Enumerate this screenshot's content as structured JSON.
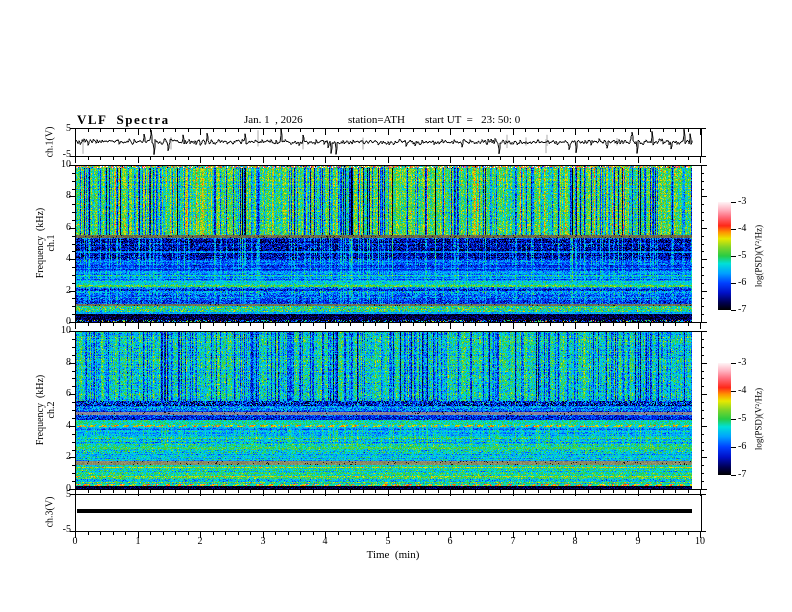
{
  "header": {
    "title": "VLF  Spectra",
    "date": "Jan. 1  , 2026",
    "station": "station=ATH",
    "start_ut": "start UT  =   23: 50: 0"
  },
  "axes": {
    "x": {
      "label": "Time  (min)",
      "range": [
        0,
        10
      ],
      "tick_labels": [
        "0",
        "1",
        "2",
        "3",
        "4",
        "5",
        "6",
        "7",
        "8",
        "9",
        "10"
      ],
      "minor_step_min": 0.2
    },
    "freq": {
      "label_line1": "Frequency  (kHz)",
      "range": [
        0,
        10
      ],
      "tick_labels": [
        "10",
        "8",
        "6",
        "4",
        "2",
        "0"
      ],
      "minor_step_khz": 0.5
    },
    "volts": {
      "range": [
        -5,
        5
      ],
      "tick_labels": [
        "5",
        "-5"
      ]
    }
  },
  "panels": {
    "ch1_wave": {
      "ylabel": "ch.1(V)"
    },
    "ch1_spec": {
      "ylabel_line2": "ch.1"
    },
    "ch2_spec": {
      "ylabel_line2": "ch.2"
    },
    "ch3_wave": {
      "ylabel": "ch.3(V)"
    }
  },
  "colorbar": {
    "label": "log(PSD)(V²/Hz)",
    "tick_labels": [
      "-3",
      "-4",
      "-5",
      "-6",
      "-7"
    ],
    "range": [
      -7,
      -3
    ],
    "stops": [
      [
        0.0,
        "#000000"
      ],
      [
        0.07,
        "#000052"
      ],
      [
        0.16,
        "#0010c8"
      ],
      [
        0.25,
        "#0040ff"
      ],
      [
        0.34,
        "#00a0ff"
      ],
      [
        0.43,
        "#00e0d8"
      ],
      [
        0.5,
        "#28cc44"
      ],
      [
        0.58,
        "#7ed428"
      ],
      [
        0.66,
        "#e8e800"
      ],
      [
        0.72,
        "#ff9400"
      ],
      [
        0.78,
        "#ff2818"
      ],
      [
        0.86,
        "#ff6a7a"
      ],
      [
        0.93,
        "#ffb4c2"
      ],
      [
        1.0,
        "#fff4f6"
      ]
    ]
  },
  "chart_data": [
    {
      "type": "line",
      "name": "ch.1 time series",
      "xlabel": "Time (min)",
      "xrange": [
        0,
        9.9
      ],
      "ylabel": "ch.1(V)",
      "yrange": [
        -5,
        5
      ],
      "baseline_V": 0,
      "noise_sd_V": 0.5,
      "spike_probability": 0.04,
      "spike_amplitude_V": [
        1.5,
        5
      ],
      "gray_spikes": 10,
      "description": "broadband noise around 0 V with impulsive sferic spikes to ±5 V"
    },
    {
      "type": "heatmap",
      "name": "ch.1 spectrogram",
      "xrange": [
        0,
        9.9
      ],
      "yrange_khz": [
        0,
        10
      ],
      "zlabel": "log(PSD)(V²/Hz)",
      "zrange": [
        -7,
        -3
      ],
      "streak_density": 0.3,
      "bands": [
        {
          "f": [
            10,
            9.9
          ],
          "psd": -4.5,
          "sd": 1.0
        },
        {
          "f": [
            9.9,
            5.55
          ],
          "psd": -4.9,
          "sd": 0.28,
          "streak": -1.5,
          "row_sd": 0.1,
          "col_sd": 0.25
        },
        {
          "f": [
            5.55,
            5.38
          ],
          "hex": "#6b6b4a"
        },
        {
          "f": [
            5.38,
            4.55
          ],
          "psd": -6.45,
          "sd": 0.35,
          "streak": 0.9,
          "row_sd": 0.15
        },
        {
          "f": [
            4.55,
            4.42
          ],
          "psd": -5.75,
          "sd": 0.2,
          "streak": 0.5
        },
        {
          "f": [
            4.42,
            3.95
          ],
          "psd": -6.35,
          "sd": 0.35,
          "streak": 0.9
        },
        {
          "f": [
            3.95,
            3.6
          ],
          "psd": -6.0,
          "sd": 0.25,
          "streak": 0.5,
          "row_sd": 0.2
        },
        {
          "f": [
            3.6,
            3.3
          ],
          "psd": -5.85,
          "sd": 0.22,
          "streak": 0.4,
          "row_sd": 0.2
        },
        {
          "f": [
            3.3,
            2.62
          ],
          "psd": -5.65,
          "sd": 0.22,
          "streak": 0.35,
          "row_sd": 0.18
        },
        {
          "f": [
            2.62,
            2.4
          ],
          "psd": -5.35,
          "sd": 0.2
        },
        {
          "f": [
            2.4,
            2.25
          ],
          "psd": -4.95,
          "sd": 0.25
        },
        {
          "f": [
            2.25,
            1.15
          ],
          "psd": -5.95,
          "sd": 0.3,
          "streak": 0.4,
          "row_sd": 0.22
        },
        {
          "f": [
            1.15,
            1.0
          ],
          "hex": "#70705a"
        },
        {
          "f": [
            1.0,
            0.62
          ],
          "psd": -5.05,
          "sd": 0.35,
          "row_sd": 0.15
        },
        {
          "f": [
            0.62,
            0.5
          ],
          "psd": -5.6,
          "sd": 0.15
        },
        {
          "f": [
            0.5,
            0.14
          ],
          "psd": -6.8,
          "sd": 0.25
        },
        {
          "f": [
            0.14,
            0
          ],
          "psd": -6.5,
          "sd": 1.2
        }
      ]
    },
    {
      "type": "heatmap",
      "name": "ch.2 spectrogram",
      "xrange": [
        0,
        9.9
      ],
      "yrange_khz": [
        0,
        10
      ],
      "zlabel": "log(PSD)(V²/Hz)",
      "zrange": [
        -7,
        -3
      ],
      "streak_density": 0.33,
      "bands": [
        {
          "f": [
            10,
            5.6
          ],
          "psd": -5.2,
          "sd": 0.3,
          "streak": -0.9,
          "row_sd": 0.12,
          "col_sd": 0.15
        },
        {
          "f": [
            5.6,
            5.28
          ],
          "psd": -6.3,
          "sd": 0.5,
          "streak": 0.4
        },
        {
          "f": [
            5.28,
            4.9
          ],
          "psd": -5.85,
          "sd": 0.3,
          "row_sd": 0.25
        },
        {
          "f": [
            4.9,
            4.72
          ],
          "hex": "#8a8596"
        },
        {
          "f": [
            4.72,
            4.38
          ],
          "psd": -5.9,
          "sd": 0.3,
          "row_sd": 0.25
        },
        {
          "f": [
            4.38,
            4.06
          ],
          "psd": -5.2,
          "sd": 0.2
        },
        {
          "f": [
            4.06,
            3.92
          ],
          "psd": -4.15,
          "sd": 0.3,
          "dash": true,
          "bg": -5.4
        },
        {
          "f": [
            3.92,
            3.34
          ],
          "psd": -5.6,
          "sd": 0.2,
          "streak": 0.35,
          "row_sd": 0.15
        },
        {
          "f": [
            3.34,
            2.7
          ],
          "psd": -5.35,
          "sd": 0.25,
          "streak": 0.3,
          "row_sd": 0.2
        },
        {
          "f": [
            2.7,
            2.52
          ],
          "psd": -4.95,
          "sd": 0.2
        },
        {
          "f": [
            2.52,
            2.28
          ],
          "psd": -5.5,
          "sd": 0.3,
          "row_sd": 0.3
        },
        {
          "f": [
            2.28,
            1.78
          ],
          "psd": -5.45,
          "sd": 0.22,
          "row_sd": 0.15
        },
        {
          "f": [
            1.78,
            1.56
          ],
          "hex": "#8a8a66"
        },
        {
          "f": [
            1.56,
            0.92
          ],
          "psd": -5.15,
          "sd": 0.25,
          "row_sd": 0.2
        },
        {
          "f": [
            0.92,
            0.6
          ],
          "psd": -5.25,
          "sd": 0.3,
          "row_sd": 0.35
        },
        {
          "f": [
            0.6,
            0.3
          ],
          "psd": -5.3,
          "sd": 0.3,
          "row_sd": 0.5
        },
        {
          "f": [
            0.3,
            0.2
          ],
          "psd": -4.3,
          "sd": 0.4,
          "dash": true,
          "bg": -5.2
        },
        {
          "f": [
            0.2,
            0
          ],
          "psd": -6.85,
          "sd": 0.2
        }
      ]
    },
    {
      "type": "line",
      "name": "ch.3 time series",
      "xrange": [
        0,
        9.9
      ],
      "ylabel": "ch.3(V)",
      "yrange": [
        -5,
        5
      ],
      "value_V": 0,
      "description": "constant 0 V thick flat trace"
    }
  ]
}
